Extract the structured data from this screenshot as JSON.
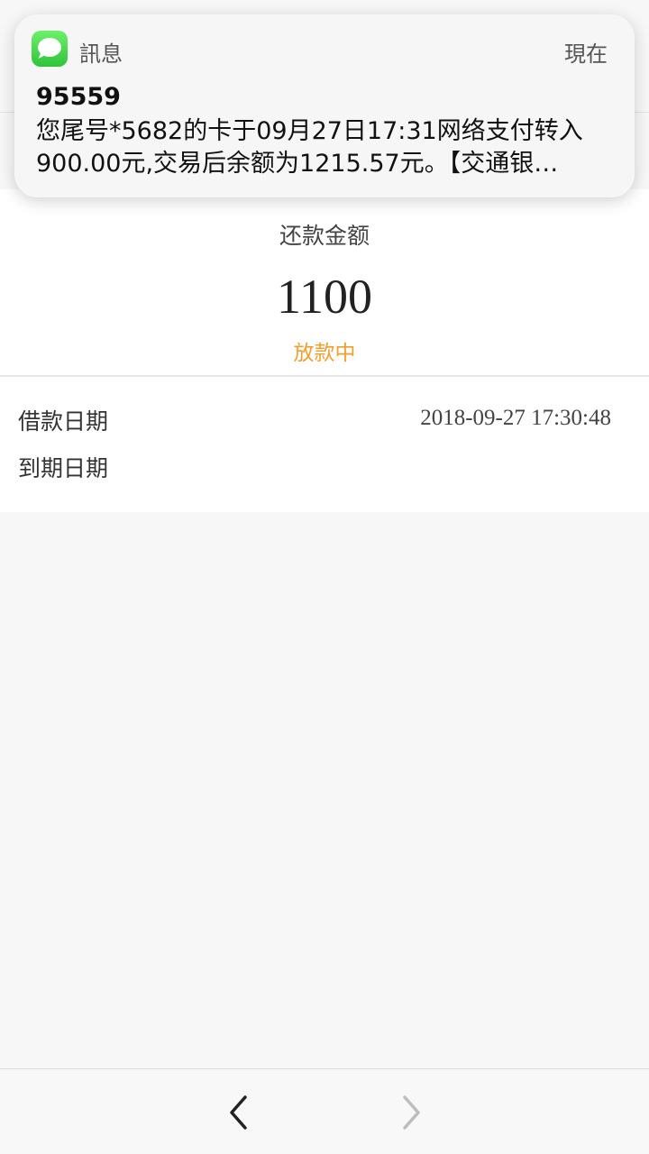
{
  "notification": {
    "app_name": "訊息",
    "time": "現在",
    "sender": "95559",
    "body": "您尾号*5682的卡于09月27日17:31网络支付转入900.00元,交易后余额为1215.57元。【交通银…",
    "icon": "messages-icon",
    "accent_color": "#34c84a"
  },
  "loan": {
    "amount_label": "还款金额",
    "amount_value": "1100",
    "status": "放款中",
    "status_color": "#f0a030",
    "details": [
      {
        "label": "借款日期",
        "value": "2018-09-27 17:30:48"
      },
      {
        "label": "到期日期",
        "value": ""
      }
    ]
  },
  "nav": {
    "back_icon": "chevron-left-icon",
    "forward_icon": "chevron-right-icon"
  }
}
